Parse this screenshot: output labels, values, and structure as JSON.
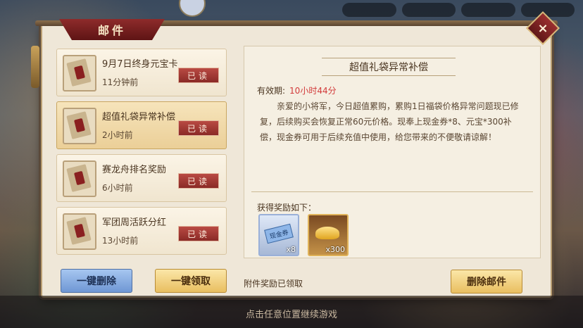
{
  "window": {
    "title": "邮件",
    "close_icon": "×"
  },
  "mails": [
    {
      "title": "9月7日终身元宝卡",
      "time": "11分钟前",
      "status": "已读"
    },
    {
      "title": "超值礼袋异常补偿",
      "time": "2小时前",
      "status": "已读"
    },
    {
      "title": "赛龙舟排名奖励",
      "time": "6小时前",
      "status": "已读"
    },
    {
      "title": "军团周活跃分红",
      "time": "13小时前",
      "status": "已读"
    }
  ],
  "left_buttons": {
    "delete_all": "一键删除",
    "claim_all": "一键领取"
  },
  "detail": {
    "title": "超值礼袋异常补偿",
    "validity_label": "有效期:",
    "validity_time": "10小时44分",
    "body": "亲爱的小将军，今日超值累购，累购1日福袋价格异常问题现已修复，后续购买会恢复正常60元价格。现奉上现金券*8、元宝*300补偿，现金券可用于后续充值中使用，给您带来的不便敬请谅解！",
    "rewards_label": "获得奖励如下：",
    "rewards": [
      {
        "icon": "cash-coupon-icon",
        "label": "现金券",
        "count": "x8"
      },
      {
        "icon": "gold-ingot-icon",
        "count": "x300"
      }
    ],
    "claim_status": "附件奖励已领取",
    "delete_button": "删除邮件"
  },
  "hint": "点击任意位置继续游戏",
  "colors": {
    "accent_red": "#8e2b2b",
    "validity_red": "#d23a3a",
    "gold": "#e9be60",
    "blue": "#6f97d4"
  }
}
